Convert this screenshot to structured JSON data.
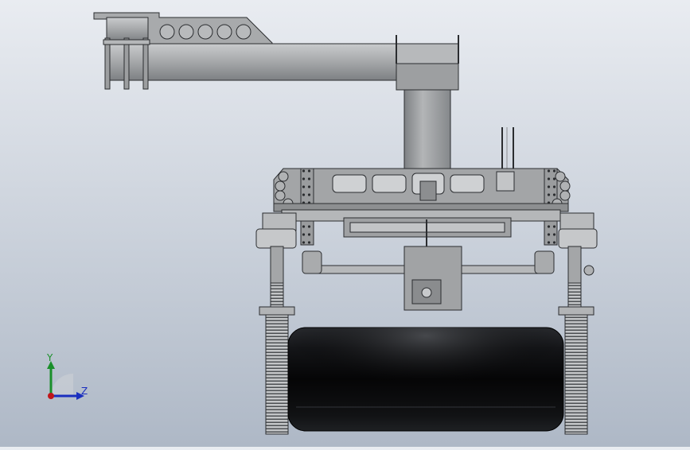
{
  "viewport": {
    "background_top": "#e9ecf1",
    "background_bottom": "#aeb8c6",
    "model_colors": {
      "metal": "#a7a9ab",
      "metal_dark": "#6e7174",
      "outline": "#2b2d30",
      "tire": "#0d0e10"
    }
  },
  "triad": {
    "y_label": "Y",
    "z_label": "Z",
    "y_color": "#1a8f2a",
    "z_color": "#1a2fbf",
    "origin_color": "#c0161b"
  }
}
